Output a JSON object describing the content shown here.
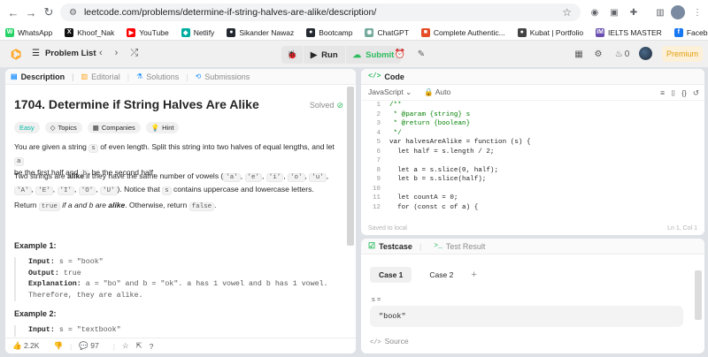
{
  "browser": {
    "url": "leetcode.com/problems/determine-if-string-halves-are-alike/description/"
  },
  "bookmarks": [
    {
      "label": "WhatsApp",
      "color": "#25d366",
      "glyph": "W"
    },
    {
      "label": "Khoof_Nak",
      "color": "#111111",
      "glyph": "X"
    },
    {
      "label": "YouTube",
      "color": "#ff0000",
      "glyph": "▶"
    },
    {
      "label": "Netlify",
      "color": "#00ad9f",
      "glyph": "◆"
    },
    {
      "label": "Sikander Nawaz",
      "color": "#24292f",
      "glyph": "●"
    },
    {
      "label": "Bootcamp",
      "color": "#24292f",
      "glyph": "●"
    },
    {
      "label": "ChatGPT",
      "color": "#74aa9c",
      "glyph": "✺"
    },
    {
      "label": "Complete Authentic...",
      "color": "#e44d26",
      "glyph": "■"
    },
    {
      "label": "Kubat | Portfolio",
      "color": "#444444",
      "glyph": "●"
    },
    {
      "label": "IELTS MASTER",
      "color": "#6a4fb0",
      "glyph": "IM"
    },
    {
      "label": "Facebook Live",
      "color": "#1877f2",
      "glyph": "f"
    }
  ],
  "topbar": {
    "problem_list": "Problem List",
    "run": "Run",
    "submit": "Submit",
    "streak": "0",
    "premium": "Premium"
  },
  "left_tabs": [
    {
      "label": "Description",
      "icon": "📄"
    },
    {
      "label": "Editorial",
      "icon": "📖"
    },
    {
      "label": "Solutions",
      "icon": "⚗"
    },
    {
      "label": "Submissions",
      "icon": "⟲"
    }
  ],
  "problem": {
    "title": "1704. Determine if String Halves Are Alike",
    "status": "Solved",
    "difficulty": "Easy",
    "chips": [
      "Topics",
      "Companies",
      "Hint"
    ],
    "p1_a": "You are given a string",
    "p1_code_s": "s",
    "p1_b": "of even length. Split this string into two halves of equal lengths, and let",
    "p1_code_a": "a",
    "p1_c": "be the first half and",
    "p1_code_b": "b",
    "p1_d": "be the second half.",
    "p2_a": "Two strings are",
    "p2_bold": "alike",
    "p2_b": "if they have the same number of vowels (",
    "vowels": [
      "'a'",
      "'e'",
      "'i'",
      "'o'",
      "'u'",
      "'A'",
      "'E'",
      "'I'",
      "'O'",
      "'U'"
    ],
    "p2_c": "). Notice that",
    "p2_code_s": "s",
    "p2_d": "contains uppercase and lowercase letters.",
    "p3_a": "Return",
    "p3_true": "true",
    "p3_b": "if",
    "p3_c": "a",
    "p3_d": "and",
    "p3_e": "b",
    "p3_f": "are",
    "p3_bold": "alike",
    "p3_g": ". Otherwise, return",
    "p3_false": "false",
    "p3_h": ".",
    "example1_title": "Example 1:",
    "ex1_input_label": "Input:",
    "ex1_input": "s = \"book\"",
    "ex1_output_label": "Output:",
    "ex1_output": "true",
    "ex1_expl_label": "Explanation:",
    "ex1_expl_1": "a = \"bo\" and b = \"ok\". a has 1 vowel and b has 1 vowel.",
    "ex1_expl_2": "Therefore, they are alike.",
    "example2_title": "Example 2:",
    "ex2_input_label": "Input:",
    "ex2_input": "s = \"textbook\""
  },
  "left_footer": {
    "likes": "2.2K",
    "comments": "97"
  },
  "code_panel": {
    "title": "Code",
    "language": "JavaScript",
    "mode": "Auto",
    "lines": [
      {
        "n": "1",
        "t": "/**"
      },
      {
        "n": "2",
        "t": " * @param {string} s"
      },
      {
        "n": "3",
        "t": " * @return {boolean}"
      },
      {
        "n": "4",
        "t": " */"
      },
      {
        "n": "5",
        "t": "var halvesAreAlike = function (s) {"
      },
      {
        "n": "6",
        "t": "  let half = s.length / 2;"
      },
      {
        "n": "7",
        "t": ""
      },
      {
        "n": "8",
        "t": "  let a = s.slice(0, half);"
      },
      {
        "n": "9",
        "t": "  let b = s.slice(half);"
      },
      {
        "n": "10",
        "t": ""
      },
      {
        "n": "11",
        "t": "  let countA = 0;"
      },
      {
        "n": "12",
        "t": "  for (const c of a) {"
      }
    ],
    "status_left": "Saved to local",
    "status_right": "Ln 1, Col 1"
  },
  "test_panel": {
    "tab_testcase": "Testcase",
    "tab_result": "Test Result",
    "cases": [
      "Case 1",
      "Case 2"
    ],
    "var_label": "s =",
    "var_value": "\"book\"",
    "source": "Source"
  },
  "colors": {
    "accent_orange": "#ffa116",
    "success_green": "#2cbb5d",
    "easy_teal": "#00b8a3"
  }
}
